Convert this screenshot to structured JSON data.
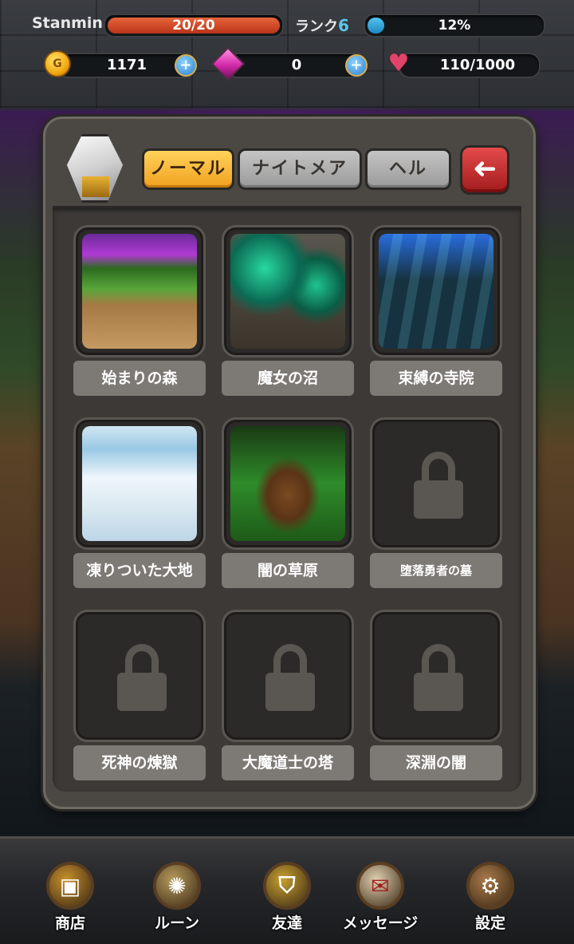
{
  "hud": {
    "player_name": "Stanmina",
    "stamina": "20/20",
    "stamina_fraction": 1.0,
    "rank_label": "ランク",
    "rank_value": "6",
    "exp": "12%",
    "exp_fraction": 0.12,
    "gold": "1171",
    "gems": "0",
    "hearts": "110/1000",
    "coin_icon_glyph": "G"
  },
  "tabs": [
    {
      "label": "ノーマル",
      "active": true
    },
    {
      "label": "ナイトメア",
      "active": false
    },
    {
      "label": "ヘル",
      "active": false
    }
  ],
  "back_glyph": "➜",
  "stages": [
    {
      "name": "始まりの森",
      "locked": false,
      "art": "forest"
    },
    {
      "name": "魔女の沼",
      "locked": false,
      "art": "swamp"
    },
    {
      "name": "束縛の寺院",
      "locked": false,
      "art": "temple"
    },
    {
      "name": "凍りついた大地",
      "locked": false,
      "art": "snow"
    },
    {
      "name": "闇の草原",
      "locked": false,
      "art": "meadow"
    },
    {
      "name": "堕落勇者の墓",
      "locked": true
    },
    {
      "name": "死神の煉獄",
      "locked": true
    },
    {
      "name": "大魔道士の塔",
      "locked": true
    },
    {
      "name": "深淵の闇",
      "locked": true
    }
  ],
  "nav": [
    {
      "label": "商店",
      "icon": "chest-icon",
      "color": "#c8902c"
    },
    {
      "label": "ルーン",
      "icon": "rune-icon",
      "color": "#b59a5c"
    },
    {
      "label": "友達",
      "icon": "helmet-icon",
      "color": "#c7a030"
    },
    {
      "label": "メッセージ",
      "icon": "mail-icon",
      "color": "#e0d0b0"
    },
    {
      "label": "設定",
      "icon": "gear-icon",
      "color": "#a87a4a"
    }
  ],
  "plus_glyph": "+"
}
